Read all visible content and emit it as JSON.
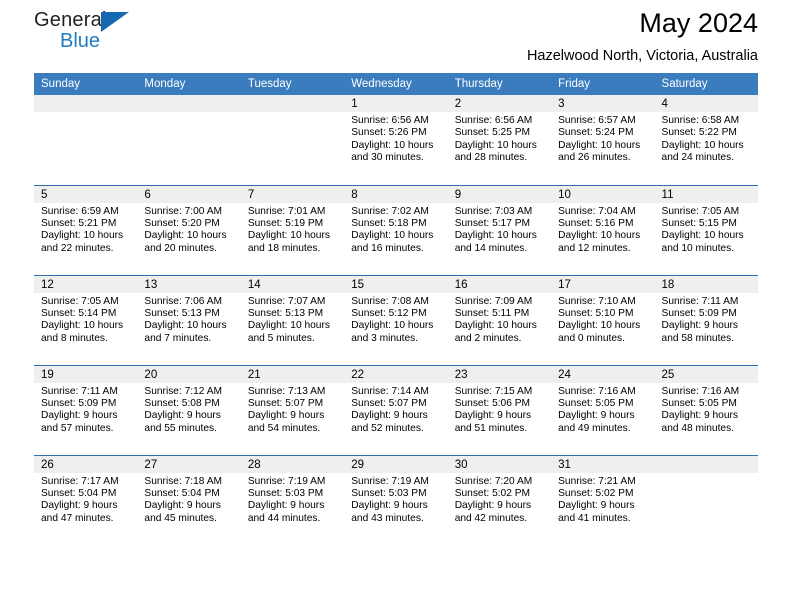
{
  "brand": {
    "name_top": "General",
    "name_bottom": "Blue",
    "accent_color": "#1668b0",
    "text_color": "#231f20"
  },
  "header": {
    "title": "May 2024",
    "subtitle": "Hazelwood North, Victoria, Australia"
  },
  "theme": {
    "header_bg": "#3a7cbe",
    "row_separator": "#2f6fb0",
    "daynum_band_bg": "#efefef",
    "page_bg": "#ffffff"
  },
  "weekday_headers": [
    "Sunday",
    "Monday",
    "Tuesday",
    "Wednesday",
    "Thursday",
    "Friday",
    "Saturday"
  ],
  "weeks": [
    [
      {
        "day": "",
        "empty": true,
        "sunrise": "",
        "sunset": "",
        "daylight_line1": "",
        "daylight_line2": ""
      },
      {
        "day": "",
        "empty": true,
        "sunrise": "",
        "sunset": "",
        "daylight_line1": "",
        "daylight_line2": ""
      },
      {
        "day": "",
        "empty": true,
        "sunrise": "",
        "sunset": "",
        "daylight_line1": "",
        "daylight_line2": ""
      },
      {
        "day": "1",
        "empty": false,
        "sunrise": "Sunrise: 6:56 AM",
        "sunset": "Sunset: 5:26 PM",
        "daylight_line1": "Daylight: 10 hours",
        "daylight_line2": "and 30 minutes."
      },
      {
        "day": "2",
        "empty": false,
        "sunrise": "Sunrise: 6:56 AM",
        "sunset": "Sunset: 5:25 PM",
        "daylight_line1": "Daylight: 10 hours",
        "daylight_line2": "and 28 minutes."
      },
      {
        "day": "3",
        "empty": false,
        "sunrise": "Sunrise: 6:57 AM",
        "sunset": "Sunset: 5:24 PM",
        "daylight_line1": "Daylight: 10 hours",
        "daylight_line2": "and 26 minutes."
      },
      {
        "day": "4",
        "empty": false,
        "sunrise": "Sunrise: 6:58 AM",
        "sunset": "Sunset: 5:22 PM",
        "daylight_line1": "Daylight: 10 hours",
        "daylight_line2": "and 24 minutes."
      }
    ],
    [
      {
        "day": "5",
        "empty": false,
        "sunrise": "Sunrise: 6:59 AM",
        "sunset": "Sunset: 5:21 PM",
        "daylight_line1": "Daylight: 10 hours",
        "daylight_line2": "and 22 minutes."
      },
      {
        "day": "6",
        "empty": false,
        "sunrise": "Sunrise: 7:00 AM",
        "sunset": "Sunset: 5:20 PM",
        "daylight_line1": "Daylight: 10 hours",
        "daylight_line2": "and 20 minutes."
      },
      {
        "day": "7",
        "empty": false,
        "sunrise": "Sunrise: 7:01 AM",
        "sunset": "Sunset: 5:19 PM",
        "daylight_line1": "Daylight: 10 hours",
        "daylight_line2": "and 18 minutes."
      },
      {
        "day": "8",
        "empty": false,
        "sunrise": "Sunrise: 7:02 AM",
        "sunset": "Sunset: 5:18 PM",
        "daylight_line1": "Daylight: 10 hours",
        "daylight_line2": "and 16 minutes."
      },
      {
        "day": "9",
        "empty": false,
        "sunrise": "Sunrise: 7:03 AM",
        "sunset": "Sunset: 5:17 PM",
        "daylight_line1": "Daylight: 10 hours",
        "daylight_line2": "and 14 minutes."
      },
      {
        "day": "10",
        "empty": false,
        "sunrise": "Sunrise: 7:04 AM",
        "sunset": "Sunset: 5:16 PM",
        "daylight_line1": "Daylight: 10 hours",
        "daylight_line2": "and 12 minutes."
      },
      {
        "day": "11",
        "empty": false,
        "sunrise": "Sunrise: 7:05 AM",
        "sunset": "Sunset: 5:15 PM",
        "daylight_line1": "Daylight: 10 hours",
        "daylight_line2": "and 10 minutes."
      }
    ],
    [
      {
        "day": "12",
        "empty": false,
        "sunrise": "Sunrise: 7:05 AM",
        "sunset": "Sunset: 5:14 PM",
        "daylight_line1": "Daylight: 10 hours",
        "daylight_line2": "and 8 minutes."
      },
      {
        "day": "13",
        "empty": false,
        "sunrise": "Sunrise: 7:06 AM",
        "sunset": "Sunset: 5:13 PM",
        "daylight_line1": "Daylight: 10 hours",
        "daylight_line2": "and 7 minutes."
      },
      {
        "day": "14",
        "empty": false,
        "sunrise": "Sunrise: 7:07 AM",
        "sunset": "Sunset: 5:13 PM",
        "daylight_line1": "Daylight: 10 hours",
        "daylight_line2": "and 5 minutes."
      },
      {
        "day": "15",
        "empty": false,
        "sunrise": "Sunrise: 7:08 AM",
        "sunset": "Sunset: 5:12 PM",
        "daylight_line1": "Daylight: 10 hours",
        "daylight_line2": "and 3 minutes."
      },
      {
        "day": "16",
        "empty": false,
        "sunrise": "Sunrise: 7:09 AM",
        "sunset": "Sunset: 5:11 PM",
        "daylight_line1": "Daylight: 10 hours",
        "daylight_line2": "and 2 minutes."
      },
      {
        "day": "17",
        "empty": false,
        "sunrise": "Sunrise: 7:10 AM",
        "sunset": "Sunset: 5:10 PM",
        "daylight_line1": "Daylight: 10 hours",
        "daylight_line2": "and 0 minutes."
      },
      {
        "day": "18",
        "empty": false,
        "sunrise": "Sunrise: 7:11 AM",
        "sunset": "Sunset: 5:09 PM",
        "daylight_line1": "Daylight: 9 hours",
        "daylight_line2": "and 58 minutes."
      }
    ],
    [
      {
        "day": "19",
        "empty": false,
        "sunrise": "Sunrise: 7:11 AM",
        "sunset": "Sunset: 5:09 PM",
        "daylight_line1": "Daylight: 9 hours",
        "daylight_line2": "and 57 minutes."
      },
      {
        "day": "20",
        "empty": false,
        "sunrise": "Sunrise: 7:12 AM",
        "sunset": "Sunset: 5:08 PM",
        "daylight_line1": "Daylight: 9 hours",
        "daylight_line2": "and 55 minutes."
      },
      {
        "day": "21",
        "empty": false,
        "sunrise": "Sunrise: 7:13 AM",
        "sunset": "Sunset: 5:07 PM",
        "daylight_line1": "Daylight: 9 hours",
        "daylight_line2": "and 54 minutes."
      },
      {
        "day": "22",
        "empty": false,
        "sunrise": "Sunrise: 7:14 AM",
        "sunset": "Sunset: 5:07 PM",
        "daylight_line1": "Daylight: 9 hours",
        "daylight_line2": "and 52 minutes."
      },
      {
        "day": "23",
        "empty": false,
        "sunrise": "Sunrise: 7:15 AM",
        "sunset": "Sunset: 5:06 PM",
        "daylight_line1": "Daylight: 9 hours",
        "daylight_line2": "and 51 minutes."
      },
      {
        "day": "24",
        "empty": false,
        "sunrise": "Sunrise: 7:16 AM",
        "sunset": "Sunset: 5:05 PM",
        "daylight_line1": "Daylight: 9 hours",
        "daylight_line2": "and 49 minutes."
      },
      {
        "day": "25",
        "empty": false,
        "sunrise": "Sunrise: 7:16 AM",
        "sunset": "Sunset: 5:05 PM",
        "daylight_line1": "Daylight: 9 hours",
        "daylight_line2": "and 48 minutes."
      }
    ],
    [
      {
        "day": "26",
        "empty": false,
        "sunrise": "Sunrise: 7:17 AM",
        "sunset": "Sunset: 5:04 PM",
        "daylight_line1": "Daylight: 9 hours",
        "daylight_line2": "and 47 minutes."
      },
      {
        "day": "27",
        "empty": false,
        "sunrise": "Sunrise: 7:18 AM",
        "sunset": "Sunset: 5:04 PM",
        "daylight_line1": "Daylight: 9 hours",
        "daylight_line2": "and 45 minutes."
      },
      {
        "day": "28",
        "empty": false,
        "sunrise": "Sunrise: 7:19 AM",
        "sunset": "Sunset: 5:03 PM",
        "daylight_line1": "Daylight: 9 hours",
        "daylight_line2": "and 44 minutes."
      },
      {
        "day": "29",
        "empty": false,
        "sunrise": "Sunrise: 7:19 AM",
        "sunset": "Sunset: 5:03 PM",
        "daylight_line1": "Daylight: 9 hours",
        "daylight_line2": "and 43 minutes."
      },
      {
        "day": "30",
        "empty": false,
        "sunrise": "Sunrise: 7:20 AM",
        "sunset": "Sunset: 5:02 PM",
        "daylight_line1": "Daylight: 9 hours",
        "daylight_line2": "and 42 minutes."
      },
      {
        "day": "31",
        "empty": false,
        "sunrise": "Sunrise: 7:21 AM",
        "sunset": "Sunset: 5:02 PM",
        "daylight_line1": "Daylight: 9 hours",
        "daylight_line2": "and 41 minutes."
      },
      {
        "day": "",
        "empty": true,
        "sunrise": "",
        "sunset": "",
        "daylight_line1": "",
        "daylight_line2": ""
      }
    ]
  ]
}
